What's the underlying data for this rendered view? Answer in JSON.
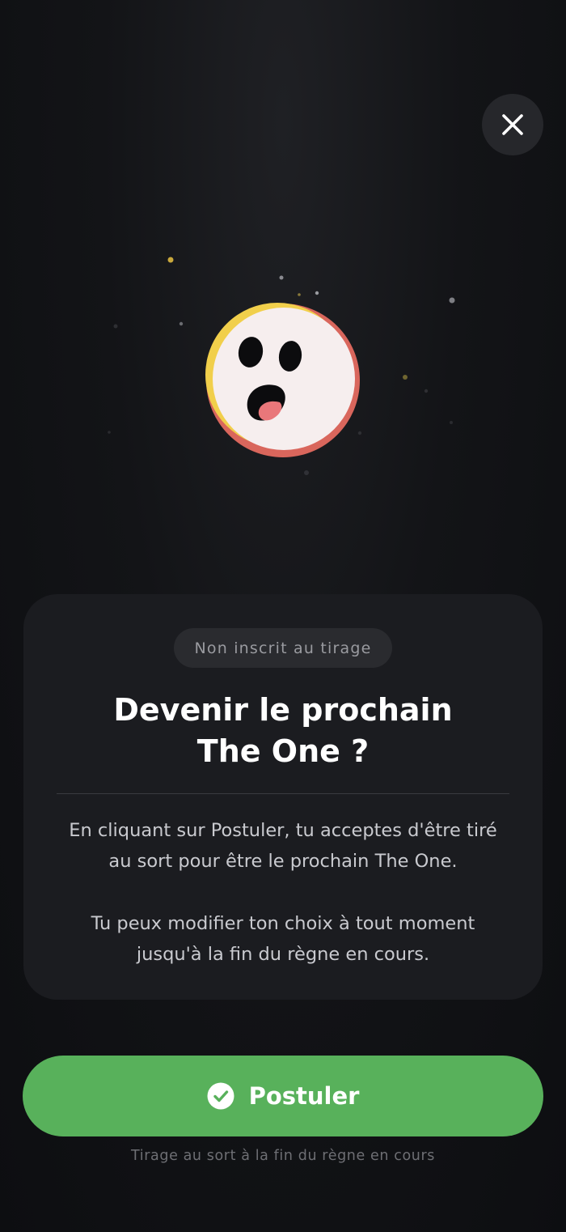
{
  "header": {
    "close_icon": "close-icon"
  },
  "hero": {
    "illustration": "shocked-face-emoji",
    "colors": {
      "face": "#f6eeee",
      "left_rim": "#f1cf4b",
      "right_rim": "#d9665c",
      "mouth": "#e9777a",
      "sparkle": "#d8b84a"
    }
  },
  "card": {
    "status_badge": "Non inscrit au tirage",
    "title_lines": [
      "Devenir le prochain",
      "The One ?"
    ],
    "paragraph1_lines": [
      "En cliquant sur Postuler, tu acceptes d'être tiré",
      "au sort pour être le prochain The One."
    ],
    "paragraph2_lines": [
      "Tu peux modifier ton choix à tout moment",
      "jusqu'à la fin du règne en cours."
    ]
  },
  "cta": {
    "label": "Postuler",
    "icon": "check-circle-icon",
    "color": "#58b15b"
  },
  "footnote": "Tirage au sort à la fin du règne en cours"
}
